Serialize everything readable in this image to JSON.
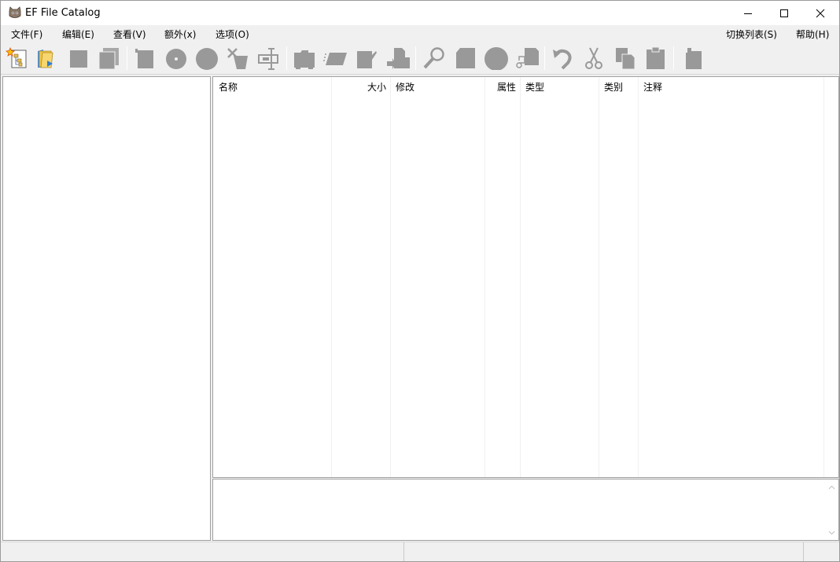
{
  "window": {
    "title": "EF File Catalog",
    "controls": [
      "minimize",
      "maximize",
      "close"
    ]
  },
  "menu": {
    "left": [
      {
        "label": "文件(F)"
      },
      {
        "label": "编辑(E)"
      },
      {
        "label": "查看(V)"
      },
      {
        "label": "额外(x)"
      },
      {
        "label": "选项(O)"
      }
    ],
    "right": [
      {
        "label": "切换列表(S)"
      },
      {
        "label": "帮助(H)"
      }
    ]
  },
  "toolbar": {
    "buttons": [
      {
        "icon": "new-catalog-icon",
        "enabled": true
      },
      {
        "icon": "open-folder-icon",
        "enabled": true
      },
      {
        "icon": "stop-icon",
        "enabled": false
      },
      {
        "icon": "copy-pages-icon",
        "enabled": false
      },
      {
        "icon": "add-media-icon",
        "enabled": false
      },
      {
        "icon": "disc-icon",
        "enabled": false
      },
      {
        "icon": "circle-icon",
        "enabled": false
      },
      {
        "icon": "delete-cross-icon",
        "enabled": false
      },
      {
        "icon": "rename-icon",
        "enabled": false
      },
      {
        "icon": "folder-icon",
        "enabled": false
      },
      {
        "icon": "parallelogram-icon",
        "enabled": false
      },
      {
        "icon": "tag-icon",
        "enabled": false
      },
      {
        "icon": "move-icon",
        "enabled": false
      },
      {
        "icon": "search-icon",
        "enabled": false
      },
      {
        "icon": "page-icon",
        "enabled": false
      },
      {
        "icon": "big-circle-icon",
        "enabled": false
      },
      {
        "icon": "link-doc-icon",
        "enabled": false
      },
      {
        "icon": "undo-icon",
        "enabled": false
      },
      {
        "icon": "cut-icon",
        "enabled": false
      },
      {
        "icon": "copy-icon",
        "enabled": false
      },
      {
        "icon": "paste-icon",
        "enabled": false
      },
      {
        "icon": "properties-icon",
        "enabled": false
      }
    ],
    "disabled_color": "#999999"
  },
  "file_list": {
    "columns": [
      {
        "label": "名称",
        "align": "left"
      },
      {
        "label": "大小",
        "align": "right"
      },
      {
        "label": "修改",
        "align": "left"
      },
      {
        "label": "属性",
        "align": "right"
      },
      {
        "label": "类型",
        "align": "left"
      },
      {
        "label": "类别",
        "align": "left"
      },
      {
        "label": "注释",
        "align": "left"
      }
    ],
    "rows": []
  },
  "colors": {
    "window_bg": "#f0f0f0",
    "pane_bg": "#ffffff",
    "border": "#a0a0a0"
  }
}
